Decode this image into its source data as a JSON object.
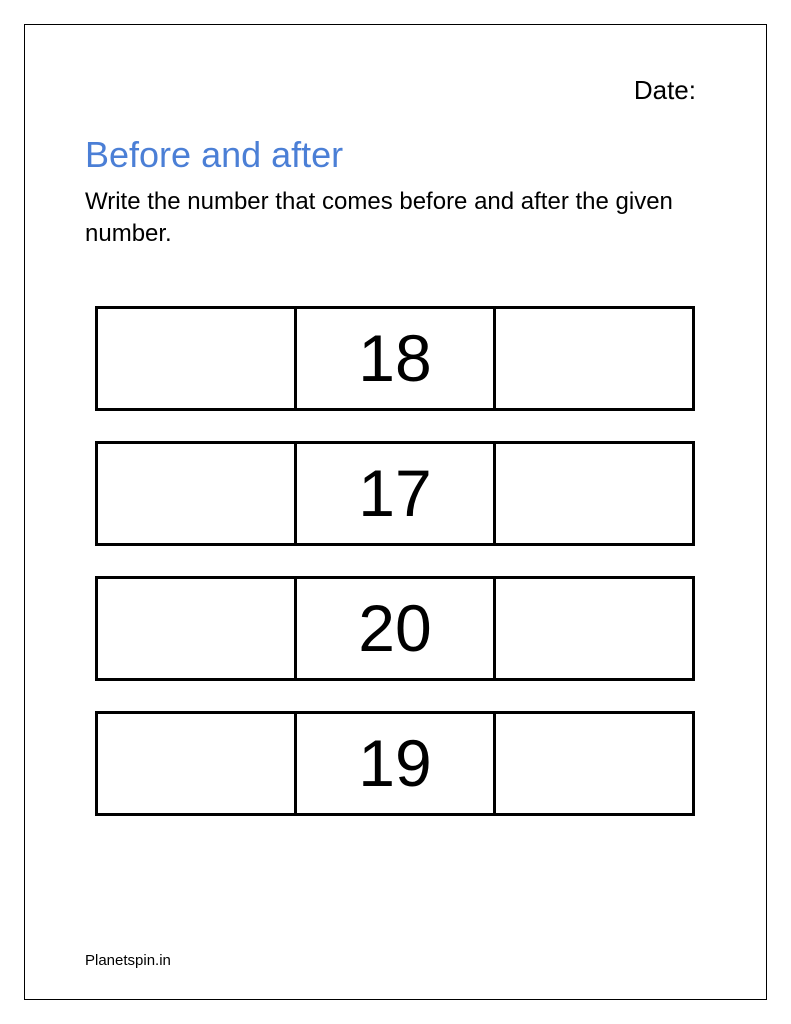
{
  "header": {
    "date_label": "Date:"
  },
  "title": "Before and after",
  "instruction": "Write the number that comes before and after the given number.",
  "rows": [
    {
      "before": "",
      "given": "18",
      "after": ""
    },
    {
      "before": "",
      "given": "17",
      "after": ""
    },
    {
      "before": "",
      "given": "20",
      "after": ""
    },
    {
      "before": "",
      "given": "19",
      "after": ""
    }
  ],
  "footer": "Planetspin.in"
}
